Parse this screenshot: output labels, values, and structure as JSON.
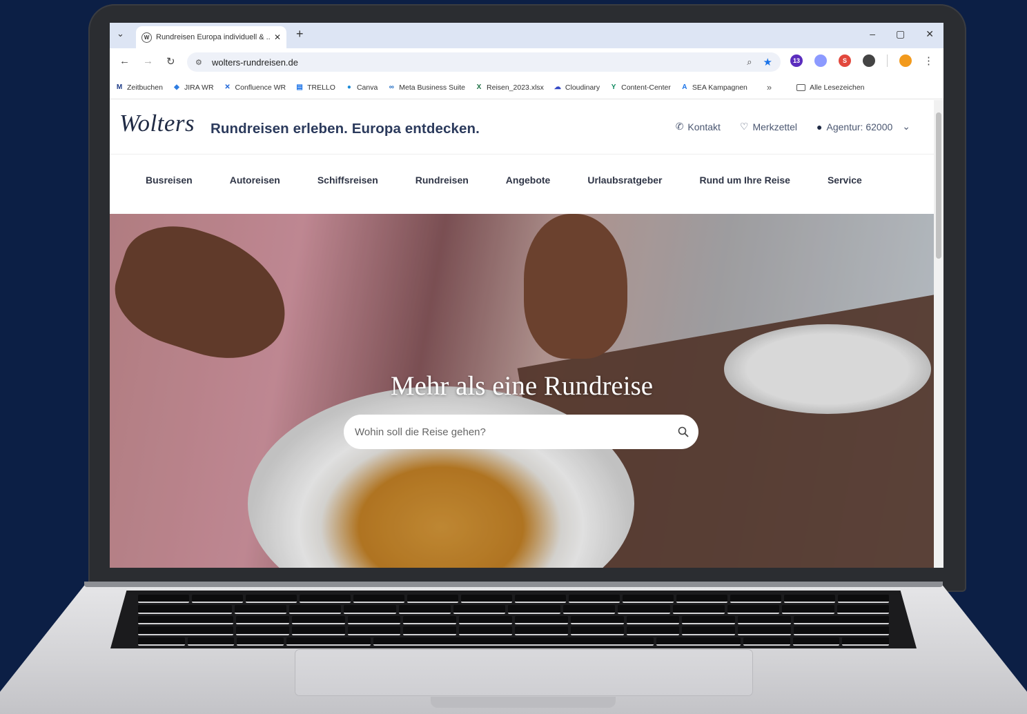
{
  "browser": {
    "tab_title": "Rundreisen Europa individuell & ...",
    "favicon_letter": "W",
    "url": "wolters-rundreisen.de",
    "window_controls": [
      "–",
      "▢",
      "✕"
    ],
    "extensions": [
      {
        "name": "extension-badge-icon",
        "color": "#5b2dbe",
        "label": "13"
      },
      {
        "name": "extension-blue-icon",
        "color": "#8c9aff",
        "label": ""
      },
      {
        "name": "extension-red-s-icon",
        "color": "#e2483d",
        "label": "S"
      },
      {
        "name": "puzzle-icon",
        "color": "#444444",
        "label": ""
      },
      {
        "name": "profile-avatar-icon",
        "color": "#f29a1d",
        "label": ""
      }
    ],
    "bookmarks": [
      {
        "label": "Zeitbuchen",
        "icon": "M",
        "color": "#1f3c88"
      },
      {
        "label": "JIRA WR",
        "icon": "◆",
        "color": "#2f7de1"
      },
      {
        "label": "Confluence WR",
        "icon": "✕",
        "color": "#1c64d8"
      },
      {
        "label": "TRELLO",
        "icon": "▤",
        "color": "#1a73e8"
      },
      {
        "label": "Canva",
        "icon": "●",
        "color": "#1b8bd6"
      },
      {
        "label": "Meta Business Suite",
        "icon": "∞",
        "color": "#1565c0"
      },
      {
        "label": "Reisen_2023.xlsx",
        "icon": "X",
        "color": "#1e7145"
      },
      {
        "label": "Cloudinary",
        "icon": "☁",
        "color": "#3448c5"
      },
      {
        "label": "Content-Center",
        "icon": "Y",
        "color": "#0f8a5f"
      },
      {
        "label": "SEA Kampagnen",
        "icon": "A",
        "color": "#1a73e8"
      }
    ],
    "bookmarks_more": "»",
    "all_bookmarks": "Alle Lesezeichen"
  },
  "site": {
    "logo": "Wolters",
    "tagline": "Rundreisen erleben. Europa entdecken.",
    "header_links": {
      "contact": "Kontakt",
      "wishlist": "Merkzettel",
      "agency": "Agentur: 62000"
    },
    "nav": [
      "Busreisen",
      "Autoreisen",
      "Schiffsreisen",
      "Rundreisen",
      "Angebote",
      "Urlaubsratgeber",
      "Rund um Ihre Reise",
      "Service"
    ],
    "hero_title": "Mehr als eine Rundreise",
    "search_placeholder": "Wohin soll die Reise gehen?",
    "brand_color": "#1f2a44"
  }
}
